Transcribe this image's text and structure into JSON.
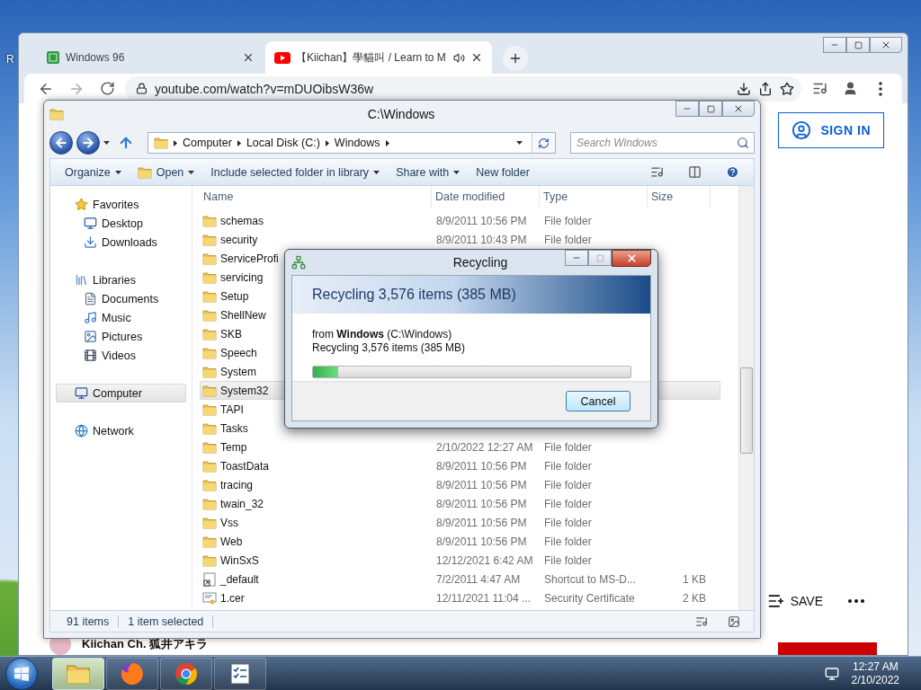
{
  "desktop": {
    "icon_labels": [
      "R"
    ]
  },
  "browser": {
    "tabs": [
      {
        "title": "Windows 96",
        "selected": false,
        "audio": false,
        "kind": "app"
      },
      {
        "title": "【Kiichan】學貓叫 / Learn to M",
        "selected": true,
        "audio": true,
        "kind": "video"
      }
    ],
    "address": "youtube.com/watch?v=mDUOibsW36w",
    "page": {
      "sign_in": "SIGN IN",
      "save": "SAVE",
      "channel": "Kiichan Ch. 狐井アキラ"
    }
  },
  "explorer": {
    "title": "C:\\Windows",
    "breadcrumbs": [
      "Computer",
      "Local Disk (C:)",
      "Windows"
    ],
    "search": {
      "placeholder": "Search Windows"
    },
    "commands": [
      {
        "label": "Organize",
        "kind": "plain",
        "dropdown": true
      },
      {
        "label": "Open",
        "kind": "open",
        "dropdown": true
      },
      {
        "label": "Include selected folder in library",
        "kind": "plain",
        "dropdown": true
      },
      {
        "label": "Share with",
        "kind": "plain",
        "dropdown": true
      },
      {
        "label": "New folder",
        "kind": "plain",
        "dropdown": false
      }
    ],
    "sidebar": [
      {
        "label": "Favorites",
        "kind": "star",
        "selected": false,
        "children": [
          {
            "label": "Desktop",
            "kind": "desktop",
            "selected": false
          },
          {
            "label": "Downloads",
            "kind": "downloads",
            "selected": false
          }
        ]
      },
      {
        "label": "Libraries",
        "kind": "libraries",
        "selected": false,
        "children": [
          {
            "label": "Documents",
            "kind": "documents",
            "selected": false
          },
          {
            "label": "Music",
            "kind": "music",
            "selected": false
          },
          {
            "label": "Pictures",
            "kind": "pictures",
            "selected": false
          },
          {
            "label": "Videos",
            "kind": "videos",
            "selected": false
          }
        ]
      },
      {
        "label": "Computer",
        "kind": "computer",
        "selected": true
      },
      {
        "label": "Network",
        "kind": "network",
        "selected": false
      }
    ],
    "columns": [
      "Name",
      "Date modified",
      "Type",
      "Size"
    ],
    "rows": [
      {
        "name": "schemas",
        "date": "8/9/2011 10:56 PM",
        "type": "File folder",
        "kind": "folder",
        "selected": false
      },
      {
        "name": "security",
        "date": "8/9/2011 10:43 PM",
        "type": "File folder",
        "kind": "folder",
        "selected": false
      },
      {
        "name": "ServiceProfi",
        "kind": "folder",
        "selected": false
      },
      {
        "name": "servicing",
        "kind": "folder",
        "selected": false
      },
      {
        "name": "Setup",
        "kind": "folder",
        "selected": false
      },
      {
        "name": "ShellNew",
        "kind": "folder",
        "selected": false
      },
      {
        "name": "SKB",
        "kind": "folder",
        "selected": false
      },
      {
        "name": "Speech",
        "kind": "folder",
        "selected": false
      },
      {
        "name": "System",
        "kind": "folder",
        "selected": false
      },
      {
        "name": "System32",
        "kind": "folder",
        "selected": true
      },
      {
        "name": "TAPI",
        "kind": "folder",
        "selected": false
      },
      {
        "name": "Tasks",
        "kind": "folder",
        "selected": false
      },
      {
        "name": "Temp",
        "date": "2/10/2022 12:27 AM",
        "type": "File folder",
        "kind": "folder",
        "selected": false
      },
      {
        "name": "ToastData",
        "date": "8/9/2011 10:56 PM",
        "type": "File folder",
        "kind": "folder",
        "selected": false
      },
      {
        "name": "tracing",
        "date": "8/9/2011 10:56 PM",
        "type": "File folder",
        "kind": "folder",
        "selected": false
      },
      {
        "name": "twain_32",
        "date": "8/9/2011 10:56 PM",
        "type": "File folder",
        "kind": "folder",
        "selected": false
      },
      {
        "name": "Vss",
        "date": "8/9/2011 10:56 PM",
        "type": "File folder",
        "kind": "folder",
        "selected": false
      },
      {
        "name": "Web",
        "date": "8/9/2011 10:56 PM",
        "type": "File folder",
        "kind": "folder",
        "selected": false
      },
      {
        "name": "WinSxS",
        "date": "12/12/2021 6:42 AM",
        "type": "File folder",
        "kind": "folder",
        "selected": false
      },
      {
        "name": "_default",
        "date": "7/2/2011 4:47 AM",
        "type": "Shortcut to MS-D...",
        "size": "1 KB",
        "kind": "shortcut",
        "selected": false
      },
      {
        "name": "1.cer",
        "date": "12/11/2021 11:04 ...",
        "type": "Security Certificate",
        "size": "2 KB",
        "kind": "certificate",
        "selected": false
      }
    ],
    "status": [
      "91 items",
      "1 item selected"
    ]
  },
  "dialog": {
    "title": "Recycling",
    "header": "Recycling 3,576 items (385 MB)",
    "source": "from **Windows** (C:\\Windows)",
    "detail": "Recycling 3,576 items (385 MB)",
    "progress": {
      "level": 0.08
    },
    "cancel": "Cancel"
  },
  "taskbar": {
    "apps": [
      {
        "kind": "explorer",
        "selected": true
      },
      {
        "kind": "firefox",
        "selected": false
      },
      {
        "kind": "chrome",
        "selected": false
      },
      {
        "kind": "tasks",
        "selected": false
      }
    ],
    "time": "12:27 AM",
    "date": "2/10/2022"
  }
}
